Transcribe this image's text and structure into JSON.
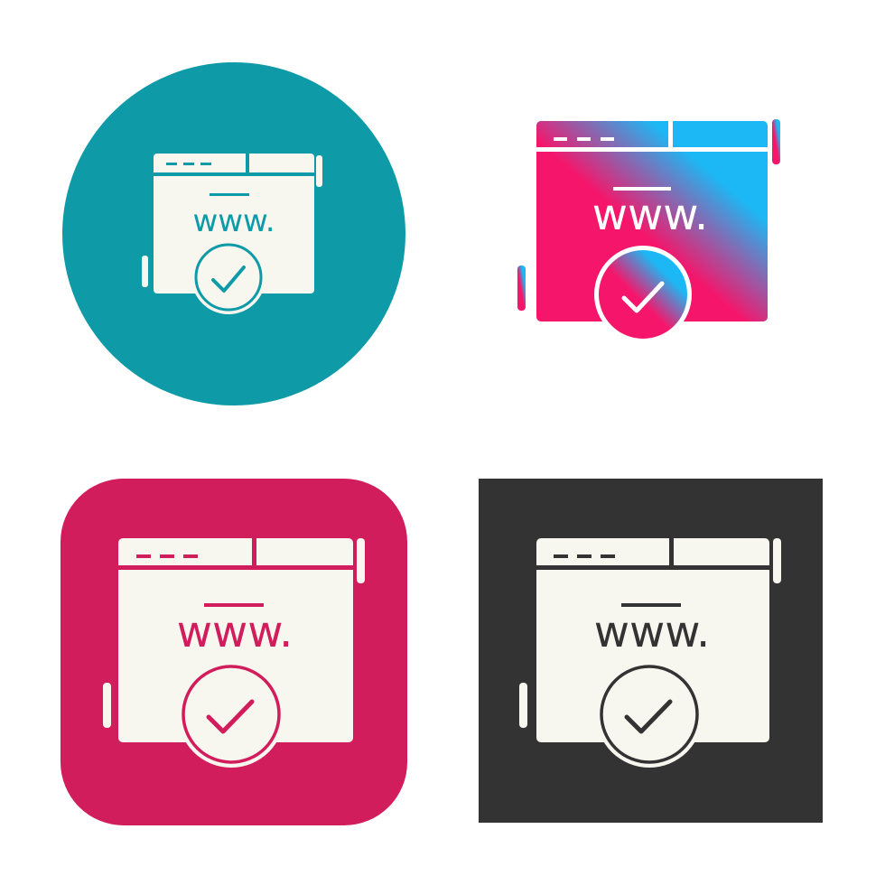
{
  "icon_text": "www.",
  "colors": {
    "teal": "#0e9aa7",
    "pink": "#d21d5c",
    "dark": "#333333",
    "glyph_fill": "#f7f6ef",
    "gradient_start": "#f5166b",
    "gradient_end": "#1cb8f5"
  },
  "icons": [
    {
      "variant": "teal-circle",
      "icon": "website-verified-icon"
    },
    {
      "variant": "gradient-glyph",
      "icon": "website-verified-icon"
    },
    {
      "variant": "pink-rounded-square",
      "icon": "website-verified-icon"
    },
    {
      "variant": "dark-square",
      "icon": "website-verified-icon"
    }
  ]
}
